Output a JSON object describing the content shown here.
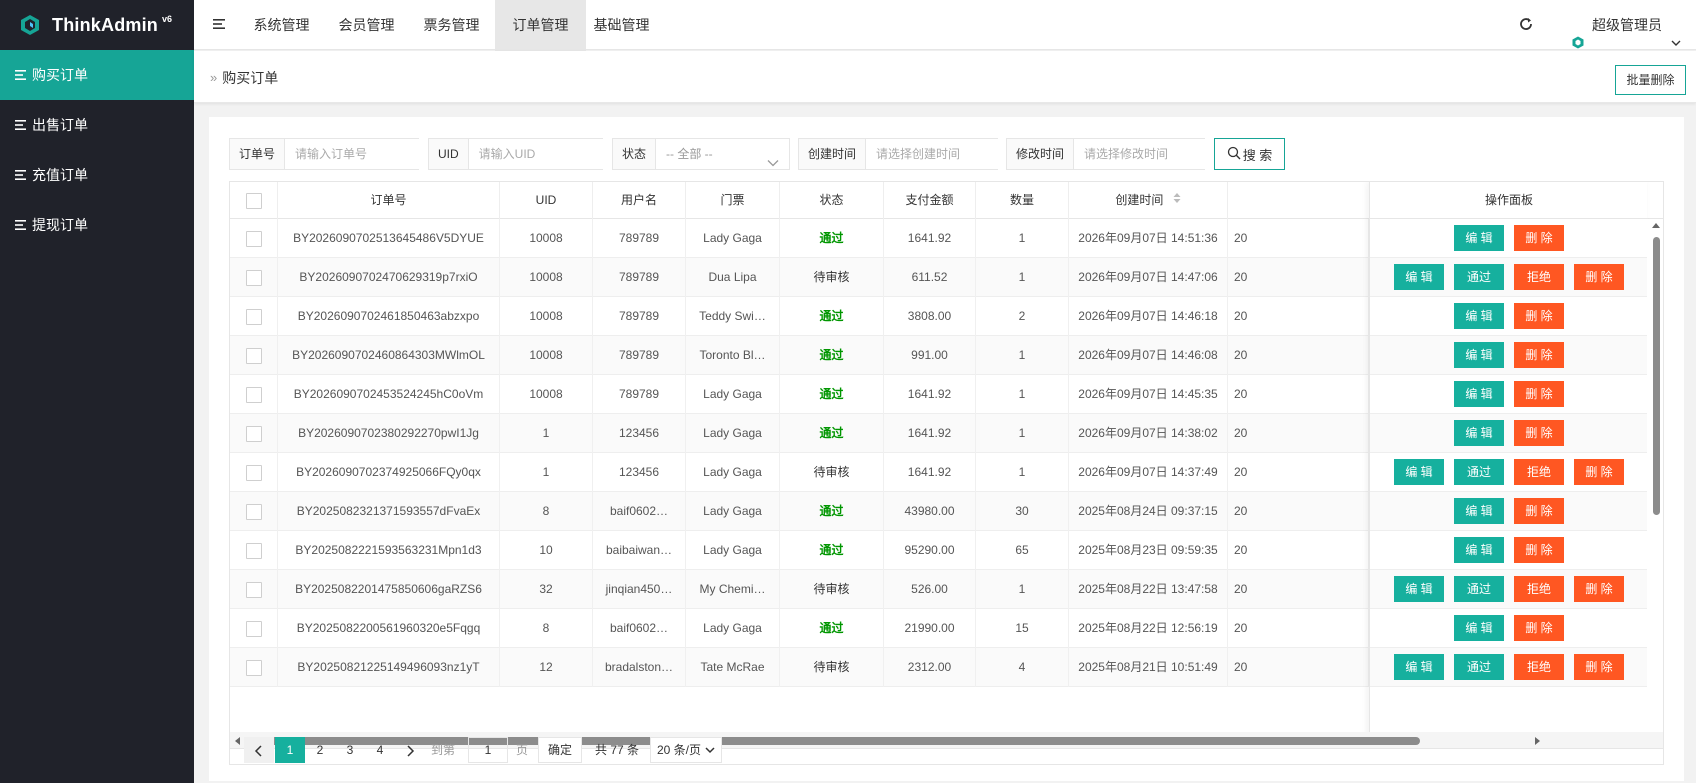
{
  "app": {
    "name": "ThinkAdmin",
    "version": "v6"
  },
  "sidebar": {
    "items": [
      {
        "label": "购买订单",
        "active": true
      },
      {
        "label": "出售订单",
        "active": false
      },
      {
        "label": "充值订单",
        "active": false
      },
      {
        "label": "提现订单",
        "active": false
      }
    ]
  },
  "header": {
    "tabs": [
      {
        "label": "系统管理",
        "active": false
      },
      {
        "label": "会员管理",
        "active": false
      },
      {
        "label": "票务管理",
        "active": false
      },
      {
        "label": "订单管理",
        "active": true
      },
      {
        "label": "基础管理",
        "active": false
      }
    ],
    "user": "超级管理员"
  },
  "breadcrumb": {
    "sep": "»",
    "title": "购买订单"
  },
  "toolbar": {
    "batch_delete": "批量删除"
  },
  "filters": {
    "order_no": {
      "label": "订单号",
      "placeholder": "请输入订单号"
    },
    "uid": {
      "label": "UID",
      "placeholder": "请输入UID"
    },
    "status": {
      "label": "状态",
      "value": "-- 全部 --"
    },
    "created": {
      "label": "创建时间",
      "placeholder": "请选择创建时间"
    },
    "modified": {
      "label": "修改时间",
      "placeholder": "请选择修改时间"
    },
    "search": "搜 索"
  },
  "table": {
    "columns": [
      "订单号",
      "UID",
      "用户名",
      "门票",
      "状态",
      "支付金额",
      "数量",
      "创建时间",
      "操作面板"
    ],
    "rows": [
      {
        "order": "BY202609070251364548​6V5DYUE",
        "uid": "10008",
        "user": "789789",
        "ticket": "Lady Gaga",
        "status": "通过",
        "amount": "1641.92",
        "qty": "1",
        "created": "2026年09月07日 14:51:36",
        "extra": "20"
      },
      {
        "order": "BY2026090702470629319p7rxiO",
        "uid": "10008",
        "user": "789789",
        "ticket": "Dua Lipa",
        "status": "待审核",
        "amount": "611.52",
        "qty": "1",
        "created": "2026年09月07日 14:47:06",
        "extra": "20"
      },
      {
        "order": "BY2026090702461850463abzxpo",
        "uid": "10008",
        "user": "789789",
        "ticket": "Teddy Swi…",
        "status": "通过",
        "amount": "3808.00",
        "qty": "2",
        "created": "2026年09月07日 14:46:18",
        "extra": "20"
      },
      {
        "order": "BY2026090702460864303MWlmOL",
        "uid": "10008",
        "user": "789789",
        "ticket": "Toronto Bl…",
        "status": "通过",
        "amount": "991.00",
        "qty": "1",
        "created": "2026年09月07日 14:46:08",
        "extra": "20"
      },
      {
        "order": "BY2026090702453524245hC0oVm",
        "uid": "10008",
        "user": "789789",
        "ticket": "Lady Gaga",
        "status": "通过",
        "amount": "1641.92",
        "qty": "1",
        "created": "2026年09月07日 14:45:35",
        "extra": "20"
      },
      {
        "order": "BY2026090702380292270pwI1Jg",
        "uid": "1",
        "user": "123456",
        "ticket": "Lady Gaga",
        "status": "通过",
        "amount": "1641.92",
        "qty": "1",
        "created": "2026年09月07日 14:38:02",
        "extra": "20"
      },
      {
        "order": "BY2026090702374925066FQy0qx",
        "uid": "1",
        "user": "123456",
        "ticket": "Lady Gaga",
        "status": "待审核",
        "amount": "1641.92",
        "qty": "1",
        "created": "2026年09月07日 14:37:49",
        "extra": "20"
      },
      {
        "order": "BY2025082321371593557dFvaEx",
        "uid": "8",
        "user": "baif0602…",
        "ticket": "Lady Gaga",
        "status": "通过",
        "amount": "43980.00",
        "qty": "30",
        "created": "2025年08月24日 09:37:15",
        "extra": "20"
      },
      {
        "order": "BY2025082221593563231Mpn1d3",
        "uid": "10",
        "user": "baibaiwan…",
        "ticket": "Lady Gaga",
        "status": "通过",
        "amount": "95290.00",
        "qty": "65",
        "created": "2025年08月23日 09:59:35",
        "extra": "20"
      },
      {
        "order": "BY2025082201475850606gaRZS6",
        "uid": "32",
        "user": "jinqian450…",
        "ticket": "My Chemi…",
        "status": "待审核",
        "amount": "526.00",
        "qty": "1",
        "created": "2025年08月22日 13:47:58",
        "extra": "20"
      },
      {
        "order": "BY2025082200561960320e5Fqgq",
        "uid": "8",
        "user": "baif0602…",
        "ticket": "Lady Gaga",
        "status": "通过",
        "amount": "21990.00",
        "qty": "15",
        "created": "2025年08月22日 12:56:19",
        "extra": "20"
      },
      {
        "order": "BY2025082122514949​6093nz1yT",
        "uid": "12",
        "user": "bradalston…",
        "ticket": "Tate McRae",
        "status": "待审核",
        "amount": "2312.00",
        "qty": "4",
        "created": "2025年08月21日 10:51:49",
        "extra": "20"
      }
    ],
    "actions": {
      "edit": "编 辑",
      "approve": "通过",
      "reject": "拒绝",
      "delete": "删 除"
    }
  },
  "pager": {
    "pages": [
      "1",
      "2",
      "3",
      "4"
    ],
    "current": "1",
    "goto_label": "到第",
    "goto_value": "1",
    "page_unit": "页",
    "confirm": "确定",
    "total": "共 77 条",
    "per_page": "20 条/页"
  },
  "colors": {
    "accent": "#16a596",
    "danger": "#ff5722",
    "sidebar": "#20222a",
    "pass": "#009600"
  }
}
